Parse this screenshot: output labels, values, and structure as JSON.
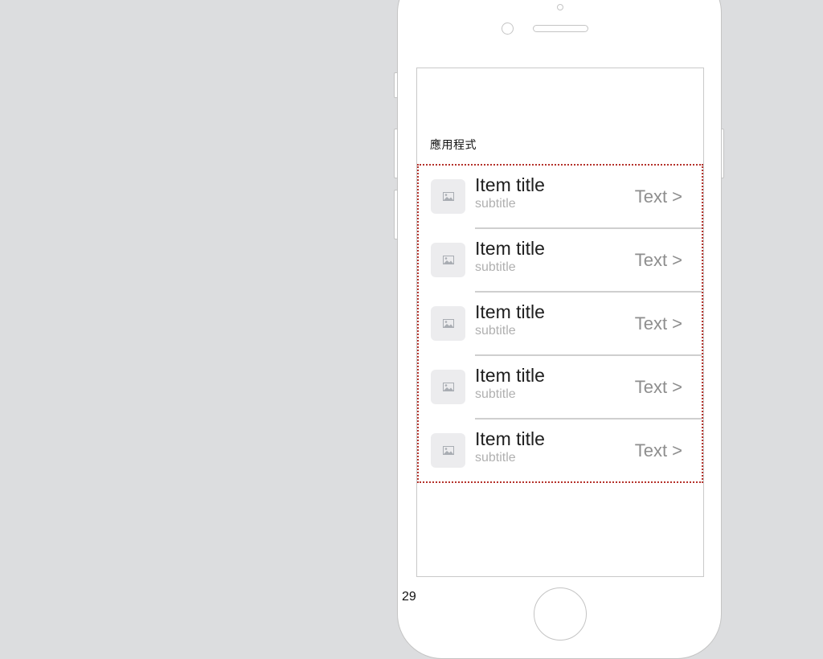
{
  "screen": {
    "section_header": "應用程式",
    "list_items": [
      {
        "title": "Item title",
        "subtitle": "subtitle",
        "accessory_text": "Text",
        "accessory_chevron": ">",
        "icon": "image-placeholder-icon"
      },
      {
        "title": "Item title",
        "subtitle": "subtitle",
        "accessory_text": "Text",
        "accessory_chevron": ">",
        "icon": "image-placeholder-icon"
      },
      {
        "title": "Item title",
        "subtitle": "subtitle",
        "accessory_text": "Text",
        "accessory_chevron": ">",
        "icon": "image-placeholder-icon"
      },
      {
        "title": "Item title",
        "subtitle": "subtitle",
        "accessory_text": "Text",
        "accessory_chevron": ">",
        "icon": "image-placeholder-icon"
      },
      {
        "title": "Item title",
        "subtitle": "subtitle",
        "accessory_text": "Text",
        "accessory_chevron": ">",
        "icon": "image-placeholder-icon"
      }
    ]
  },
  "footer": {
    "page_number": "29"
  },
  "colors": {
    "background": "#dcdddf",
    "selection_outline": "#b5322b",
    "title": "#1e1e1e",
    "subtitle": "#b0b0b0",
    "accessory": "#8e8e8e"
  }
}
